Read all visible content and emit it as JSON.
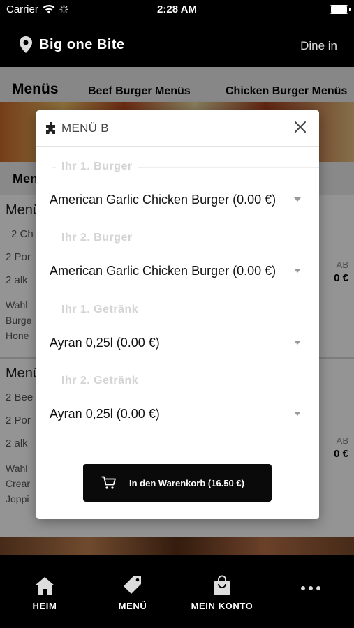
{
  "status": {
    "carrier": "Carrier",
    "time": "2:28 AM"
  },
  "header": {
    "restaurant": "Big one Bite",
    "mode": "Dine in",
    "icon": "location-pin-icon"
  },
  "background": {
    "tabs": [
      "Menüs",
      "Beef Burger Menüs",
      "Chicken Burger Menüs"
    ],
    "section_title": "Menü",
    "cards": [
      {
        "title": "Menü",
        "lines": [
          "2 Ch",
          "2 Por",
          "2 alk"
        ],
        "desc": [
          "Wahl",
          "Burge",
          "Hone"
        ],
        "tag": "AB",
        "price": "0 €"
      },
      {
        "title": "Menü",
        "lines": [
          "2 Bee",
          "2 Por",
          "2 alk"
        ],
        "desc": [
          "Wahl",
          "Crear",
          "Joppi"
        ],
        "tag": "AB",
        "price": "0 €"
      }
    ]
  },
  "modal": {
    "title": "MENÜ B",
    "icon": "puzzle-icon",
    "groups": [
      {
        "label": "Ihr 1. Burger",
        "value": "American Garlic Chicken Burger (0.00 €)"
      },
      {
        "label": "Ihr 2. Burger",
        "value": "American Garlic Chicken Burger (0.00 €)"
      },
      {
        "label": "Ihr 1. Getränk",
        "value": "Ayran 0,25l (0.00 €)"
      },
      {
        "label": "Ihr 2. Getränk",
        "value": "Ayran 0,25l (0.00 €)"
      }
    ],
    "add_to_cart": "In den Warenkorb (16.50 €)"
  },
  "nav": [
    {
      "label": "HEIM",
      "icon": "home-icon"
    },
    {
      "label": "MENÜ",
      "icon": "tag-icon"
    },
    {
      "label": "MEIN KONTO",
      "icon": "shopping-bag-icon"
    },
    {
      "label": "",
      "icon": "more-dots-icon"
    }
  ]
}
